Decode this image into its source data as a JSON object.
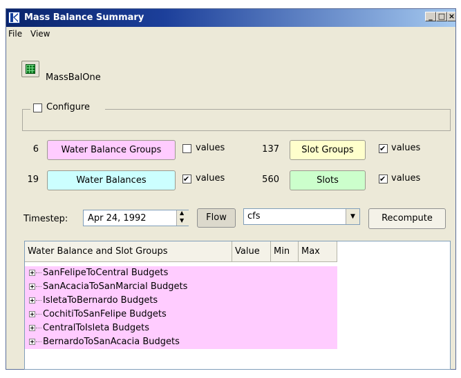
{
  "window": {
    "title": "Mass Balance Summary",
    "minimize": "_",
    "maximize": "□",
    "close": "×"
  },
  "menu": [
    "File",
    "View"
  ],
  "header": {
    "name": "MassBalOne"
  },
  "configure": {
    "label": "Configure",
    "checked": false
  },
  "groups": {
    "water_balance_groups": {
      "count": "6",
      "label": "Water Balance Groups",
      "color": "#ffccff",
      "values_label": "values",
      "checked": false
    },
    "water_balances": {
      "count": "19",
      "label": "Water Balances",
      "color": "#ccffff",
      "values_label": "values",
      "checked": true
    },
    "slot_groups": {
      "count": "137",
      "label": "Slot Groups",
      "color": "#ffffcc",
      "values_label": "values",
      "checked": true
    },
    "slots": {
      "count": "560",
      "label": "Slots",
      "color": "#ccffcc",
      "values_label": "values",
      "checked": true
    }
  },
  "timestep": {
    "label": "Timestep:",
    "value": "Apr 24, 1992"
  },
  "flow_button": "Flow",
  "units": {
    "selected": "cfs"
  },
  "recompute_button": "Recompute",
  "table": {
    "columns": [
      "Water Balance and Slot Groups",
      "Value",
      "Min",
      "Max"
    ],
    "rows": [
      "SanFelipeToCentral Budgets",
      "SanAcaciaToSanMarcial Budgets",
      "IsletaToBernardo Budgets",
      "CochitiToSanFelipe Budgets",
      "CentralToIsleta Budgets",
      "BernardoToSanAcacia Budgets"
    ],
    "row_color": "#ffccff"
  }
}
